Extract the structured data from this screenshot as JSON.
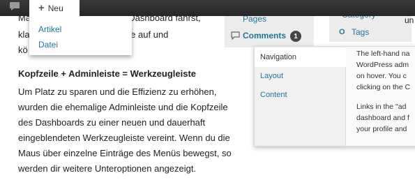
{
  "adminbar": {
    "comments_icon": "speech-bubble-icon",
    "new_icon": "plus-icon",
    "new_label": "Neu",
    "dropdown": [
      "Artikel",
      "Datei"
    ]
  },
  "article": {
    "lines_top": [
      "Mausschaltfläche über das Dashboard fährst,",
      "klappen sich die Menüpunkte auf und",
      "kö"
    ],
    "heading": "Kopfzeile + Adminleiste = Werkzeugleiste",
    "paragraph": [
      "Um Platz zu sparen und die Effizienz zu erhöhen,",
      "wurden die ehemalige Adminleiste und die Kopfzeile",
      "des Dashboards zu einer neuen und dauerhaft",
      "eingeblendeten Werkzeugleiste vereint. Wenn du die",
      "Maus über einzelne Einträge des Menüs bewegst, so",
      "werden dir weitere Unteroptionen angezeigt."
    ]
  },
  "background_menu": {
    "pages": "Pages",
    "comments": "Comments",
    "comments_count": "1",
    "category": "Category",
    "tags": "Tags",
    "far_right": "un"
  },
  "help_popup": {
    "tabs": [
      "Navigation",
      "Layout",
      "Content"
    ],
    "active_tab": "Navigation",
    "text_lines": [
      "The left-hand na",
      "WordPress adm",
      "on hover. You c",
      "clicking on the C",
      "",
      "Links in the \"ad",
      "dashboard and f",
      "your profile and"
    ]
  },
  "colors": {
    "link": "#21759b",
    "adminbar": "#2e2e2e",
    "badge": "#464646"
  }
}
